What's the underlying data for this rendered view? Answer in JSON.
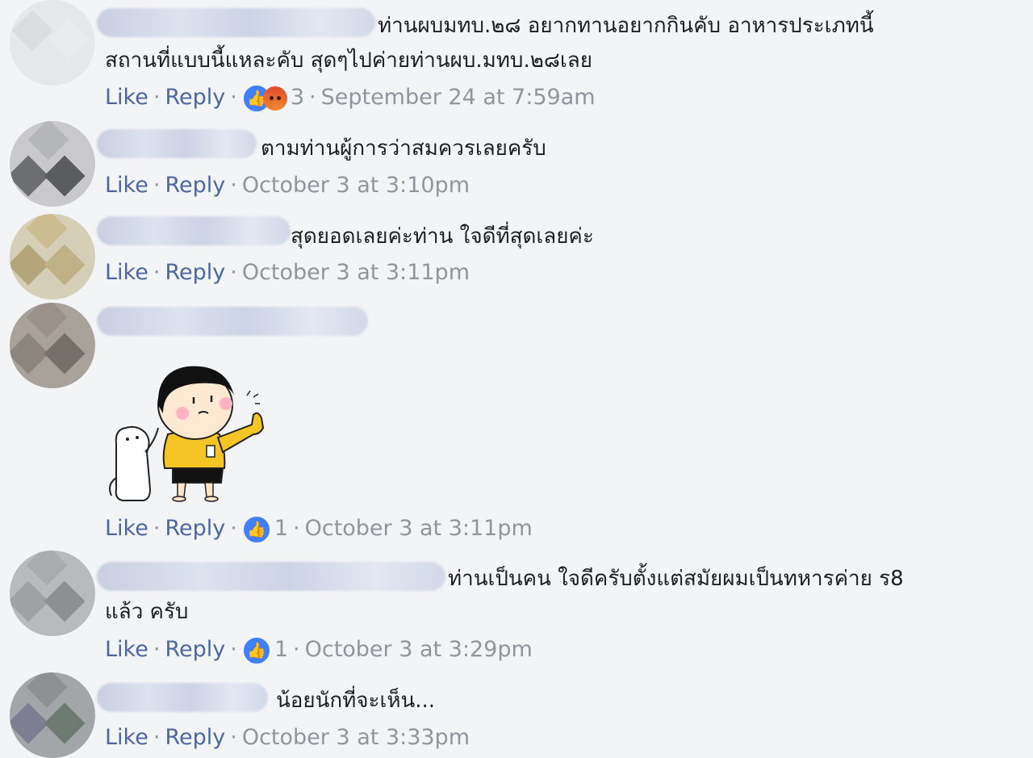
{
  "actions": {
    "like": "Like",
    "reply": "Reply",
    "separator": "·"
  },
  "colors": {
    "link": "#4b67a1",
    "meta": "#90949c",
    "text": "#1c1e21",
    "reaction_blue": "#4080ff"
  },
  "comments": [
    {
      "text_line1": "ท่านผบมทบ.๒๘ อยากทานอยากกินคับ อาหารประเภทนี้",
      "text_line2": "สถานที่แบบนี้แหละคับ สุดๆไปค่ายท่านผบ.มทบ.๒๘เลย",
      "reaction_icons": [
        "like-icon",
        "angry-icon"
      ],
      "reaction_count": "3",
      "timestamp": "September 24 at 7:59am"
    },
    {
      "text_line1": "ตามท่านผู้การว่าสมควรเลยครับ",
      "timestamp": "October 3 at 3:10pm"
    },
    {
      "text_line1": "สุดยอดเลยค่ะท่าน ใจดีที่สุดเลยค่ะ",
      "timestamp": "October 3 at 3:11pm"
    },
    {
      "sticker": "girl-thumbs-up-with-cat-sticker",
      "reaction_icons": [
        "like-icon"
      ],
      "reaction_count": "1",
      "timestamp": "October 3 at 3:11pm"
    },
    {
      "text_line1": "ท่านเป็นคน ใจดีครับตั้งแต่สมัยผมเป็นทหารค่าย ร8",
      "text_line2": "แล้ว ครับ",
      "reaction_icons": [
        "like-icon"
      ],
      "reaction_count": "1",
      "timestamp": "October 3 at 3:29pm"
    },
    {
      "text_line1": "น้อยนักที่จะเห็น...",
      "timestamp": "October 3 at 3:33pm"
    }
  ]
}
